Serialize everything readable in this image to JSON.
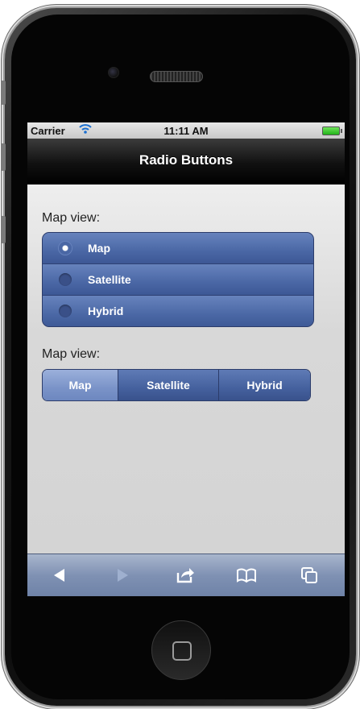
{
  "status_bar": {
    "carrier": "Carrier",
    "time": "11:11 AM"
  },
  "nav": {
    "title": "Radio Buttons"
  },
  "radio_section": {
    "label": "Map view:",
    "options": [
      "Map",
      "Satellite",
      "Hybrid"
    ],
    "selected": "Map"
  },
  "segment_section": {
    "label": "Map view:",
    "options": [
      "Map",
      "Satellite",
      "Hybrid"
    ],
    "selected": "Map"
  },
  "toolbar": {
    "icons": [
      "back-arrow-icon",
      "forward-arrow-icon",
      "share-icon",
      "bookmarks-icon",
      "tabs-icon"
    ]
  },
  "colors": {
    "accent": "#4a67a5",
    "selected_segment": "#7a93c8",
    "toolbar": "#7f91b3"
  }
}
